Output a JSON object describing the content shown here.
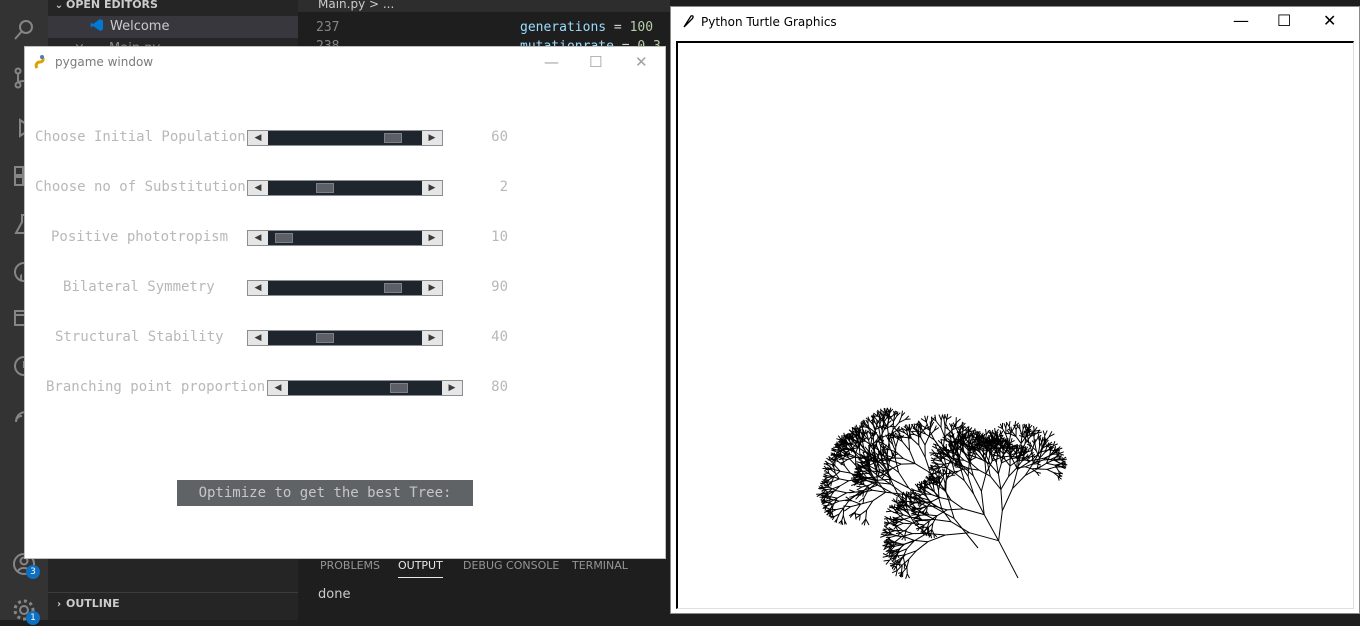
{
  "vscode": {
    "sidebar": {
      "open_editors_label": "OPEN EDITORS",
      "welcome_label": "Welcome",
      "main_label": "Main.py",
      "outline_label": "OUTLINE"
    },
    "editor_tab": "Main.py > ...",
    "lines": [
      {
        "num": "237",
        "var": "generations",
        "op": " = ",
        "val": "100"
      },
      {
        "num": "238",
        "var": "mutationrate",
        "op": " = ",
        "val": "0.3"
      }
    ],
    "panel": {
      "tabs": [
        "PROBLEMS",
        "OUTPUT",
        "DEBUG CONSOLE",
        "TERMINAL"
      ],
      "output": "done"
    },
    "badges": {
      "accounts": "3",
      "settings": "1"
    },
    "activity_icons": [
      "search-icon",
      "source-control-icon",
      "run-debug-icon",
      "extensions-icon",
      "test-icon",
      "github-icon",
      "remote-explorer-icon",
      "timeline-icon",
      "live-share-icon",
      "account-icon",
      "settings-gear-icon"
    ]
  },
  "pygame": {
    "title": "pygame window",
    "sliders": [
      {
        "label": "Choose Initial Population",
        "value": "60",
        "level": 0.85
      },
      {
        "label": "Choose no of Substitution",
        "value": "2",
        "level": 0.35
      },
      {
        "label": "Positive phototropism",
        "value": "10",
        "level": 0.05
      },
      {
        "label": "Bilateral Symmetry",
        "value": "90",
        "level": 0.85
      },
      {
        "label": "Structural Stability",
        "value": "40",
        "level": 0.35
      },
      {
        "label": "Branching point proportion",
        "value": "80",
        "level": 0.75
      }
    ],
    "button_label": "Optimize to get the best Tree:"
  },
  "turtle": {
    "title": "Python Turtle Graphics"
  }
}
